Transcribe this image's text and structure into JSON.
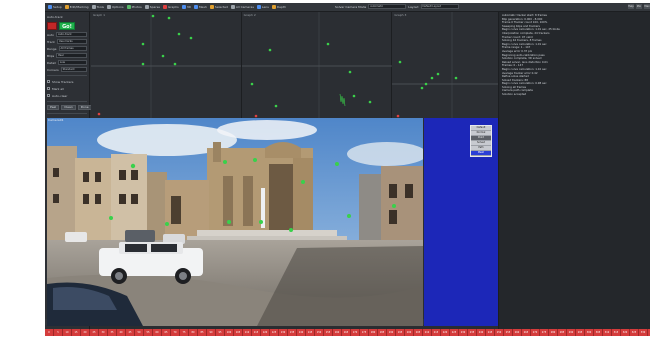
{
  "toolbar": {
    "buttons": [
      {
        "label": "Setup",
        "icon": "setup-icon",
        "color": "#4e8ff0"
      },
      {
        "label": "Edit/Marking",
        "icon": "edit-icon",
        "color": "#e0a030"
      },
      {
        "label": "Tools",
        "icon": "tools-icon",
        "color": "#9da4ab"
      },
      {
        "label": "Options",
        "icon": "options-icon",
        "color": "#9da4ab"
      },
      {
        "label": "Photos",
        "icon": "photos-icon",
        "color": "#59b86a"
      },
      {
        "label": "Sparse",
        "icon": "sparse-icon",
        "color": "#9da4ab"
      },
      {
        "label": "Graphs",
        "icon": "graph-icon",
        "color": "#e04040"
      },
      {
        "label": "3D",
        "icon": "cube-icon",
        "color": "#4e8ff0"
      },
      {
        "label": "Mesh",
        "icon": "mesh-icon",
        "color": "#4e8ff0"
      },
      {
        "label": "Selected",
        "icon": "select-icon",
        "color": "#e0a030"
      },
      {
        "label": "All Cameras",
        "icon": "cameras-icon",
        "color": "#9da4ab"
      },
      {
        "label": "Lens",
        "icon": "lens-icon",
        "color": "#4e8ff0"
      },
      {
        "label": "Depth",
        "icon": "depth-icon",
        "color": "#e0a030"
      }
    ],
    "solver_label": "Solver Camera Mode",
    "solver_value": "Automatic",
    "layout_label": "Layout",
    "layout_value": "Default Layout",
    "window_buttons": [
      "Help",
      "Min",
      "Max"
    ]
  },
  "left_panel": {
    "header": "Auto-track",
    "go_label": "Go!",
    "rows": [
      {
        "label": "Auto",
        "value": "Auto-track"
      },
      {
        "label": "Track",
        "value": "Use marks"
      },
      {
        "label": "Range",
        "value": "All frames"
      },
      {
        "label": "Blips",
        "value": "Peel"
      },
      {
        "label": "Detail",
        "value": "Low"
      },
      {
        "label": "Corners",
        "value": "Standard"
      }
    ],
    "checks": [
      "Show Trackers",
      "Mark all",
      "Auto-clear"
    ],
    "controls": [
      "Peel",
      "Clean",
      "Done"
    ],
    "lower": [
      "Blips per frame",
      "Deflicker",
      "Large"
    ],
    "buttons": [
      "Run",
      "Stop",
      "Reset"
    ]
  },
  "graphs": [
    {
      "title": "Graph 1"
    },
    {
      "title": "Graph 2"
    },
    {
      "title": "Graph 3"
    }
  ],
  "console": {
    "lines": [
      "Automatic tracker start: 8 frames",
      "Blip generation: 0.000 - 8.000",
      "Frame 0 Tracker count 100, 100%",
      "Sweeping blips and trackers",
      "Begin curve calculation: 1.01 sec, 25 blobs",
      "Interpolation complete, 24 trackers",
      "Tracker count: 97 valid",
      "Solving 44 trackers, 8 frames",
      "Begin curve calculation: 1.01 sec",
      "Frame range: 1 - 147",
      "Average error 0.37 pix",
      "Beginning auto-calibration pass",
      "Solution complete, 3D solved",
      "Reload solver, lens distortion 0.01",
      "Frames: 0 - 147",
      "Begin curve calculation: 1.10 sec",
      "Average tracker error 0.42",
      "Refine solve started",
      "Solved trackers: 88",
      "Begin curve calculation: 0.98 sec",
      "Solving all frames",
      "Camera path complete",
      "Solution accepted"
    ]
  },
  "viewport": {
    "label": "Camera01",
    "status_chips": [
      "Frm",
      "1",
      "In",
      "Out",
      "Pan",
      "Zoom",
      "Fit",
      "Sel",
      "Trk",
      "Kf",
      "Sync"
    ]
  },
  "blue_panel": {
    "menu": [
      "Default",
      "Normal",
      "Point",
      "Solved",
      "Path",
      "Mesh"
    ]
  },
  "ruler": {
    "frames": [
      "0",
      "5",
      "10",
      "15",
      "20",
      "25",
      "30",
      "35",
      "40",
      "45",
      "50",
      "55",
      "60",
      "65",
      "70",
      "75",
      "80",
      "85",
      "90",
      "95",
      "100",
      "105",
      "110",
      "115",
      "120",
      "125",
      "130",
      "135",
      "140",
      "145",
      "150",
      "155",
      "160",
      "165",
      "170",
      "175",
      "180",
      "185",
      "190",
      "195",
      "200",
      "205",
      "210",
      "215",
      "220",
      "225",
      "230",
      "235",
      "240",
      "245",
      "250",
      "255",
      "260",
      "265",
      "270",
      "275",
      "280",
      "285",
      "290",
      "295",
      "300",
      "305",
      "310",
      "315",
      "320",
      "325",
      "330",
      "335",
      "340",
      "345",
      "350"
    ]
  }
}
